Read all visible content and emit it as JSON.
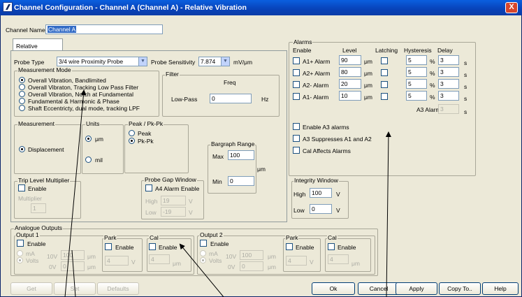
{
  "window": {
    "title": "Channel Configuration - Channel A (Channel A) - Relative Vibration",
    "close": "X"
  },
  "channel_name": {
    "label": "Channel Name",
    "value": "Channel A"
  },
  "tab": "Relative Vibration",
  "probe": {
    "type_label": "Probe Type",
    "type_value": "3/4 wire Proximity Probe",
    "sens_label": "Probe Sensitivity",
    "sens_value": "7.874",
    "sens_unit": "mV/μm"
  },
  "measurement_mode": {
    "title": "Measurement Mode",
    "options": [
      "Overall Vibration, Bandlimited",
      "Overall Vibraton, Tracking Low Pass Filter",
      "Overall Vibration, Notch at Fundamental",
      "Fundamental & Harmonic & Phase",
      "Shaft Eccentricty, dual mode, tracking LPF"
    ],
    "selected": 0
  },
  "filter": {
    "title": "Filter",
    "freq_label": "Freq",
    "lowpass_label": "Low-Pass",
    "value": "0",
    "unit": "Hz"
  },
  "measurement": {
    "title": "Measurement",
    "option": "Displacement"
  },
  "units": {
    "title": "Units",
    "um": "μm",
    "mil": "mil",
    "selected": "um"
  },
  "peak": {
    "title": "Peak / Pk-Pk",
    "peak": "Peak",
    "pkpk": "Pk-Pk",
    "selected": "pkpk"
  },
  "bargraph": {
    "title": "Bargraph Range",
    "max_label": "Max",
    "max_value": "100",
    "unit": "μm",
    "min_label": "Min",
    "min_value": "0"
  },
  "trip": {
    "title": "Trip Level Multiplier",
    "enable": "Enable",
    "mult_label": "Multiplier",
    "mult_value": "1"
  },
  "probe_gap": {
    "title": "Probe Gap Window",
    "enable": "A4 Alarm Enable",
    "high_label": "High",
    "high_value": "19",
    "low_label": "Low",
    "low_value": "-19",
    "unit": "V"
  },
  "alarms": {
    "title": "Alarms",
    "hdr_enable": "Enable",
    "hdr_level": "Level",
    "hdr_latching": "Latching",
    "hdr_hyst": "Hysteresis",
    "hdr_delay": "Delay",
    "rows": [
      {
        "label": "A1+ Alarm",
        "level": "90",
        "unit": "μm",
        "hyst": "5",
        "pct": "%",
        "delay": "3",
        "s": "s"
      },
      {
        "label": "A2+ Alarm",
        "level": "80",
        "unit": "μm",
        "hyst": "5",
        "pct": "%",
        "delay": "3",
        "s": "s"
      },
      {
        "label": "A2- Alarm",
        "level": "20",
        "unit": "μm",
        "hyst": "5",
        "pct": "%",
        "delay": "3",
        "s": "s"
      },
      {
        "label": "A1- Alarm",
        "level": "10",
        "unit": "μm",
        "hyst": "5",
        "pct": "%",
        "delay": "3",
        "s": "s"
      }
    ],
    "a3_label": "A3 Alarm",
    "a3_value": "3",
    "a3_s": "s",
    "enable_a3": "Enable A3 alarms",
    "a3_supp": "A3 Suppresses A1 and A2",
    "cal_affects": "Cal Affects Alarms"
  },
  "integrity": {
    "title": "Integrity Window",
    "high_label": "High",
    "high_value": "100",
    "low_label": "Low",
    "low_value": "0",
    "unit": "V"
  },
  "analogue": {
    "title": "Analogue Outputs",
    "out1": "Output 1",
    "out2": "Output 2",
    "enable": "Enable",
    "ma": "mA",
    "volts": "Volts",
    "v10": "10V",
    "v10_val": "100",
    "v0": "0V",
    "v0_val": "0",
    "um": "μm",
    "park": "Park",
    "park_val": "4",
    "v": "V",
    "cal": "Cal",
    "cal_val": "4"
  },
  "buttons": {
    "get": "Get",
    "set": "Set",
    "defaults": "Defaults",
    "ok": "Ok",
    "cancel": "Cancel",
    "apply": "Apply",
    "copy": "Copy To..",
    "help": "Help"
  }
}
